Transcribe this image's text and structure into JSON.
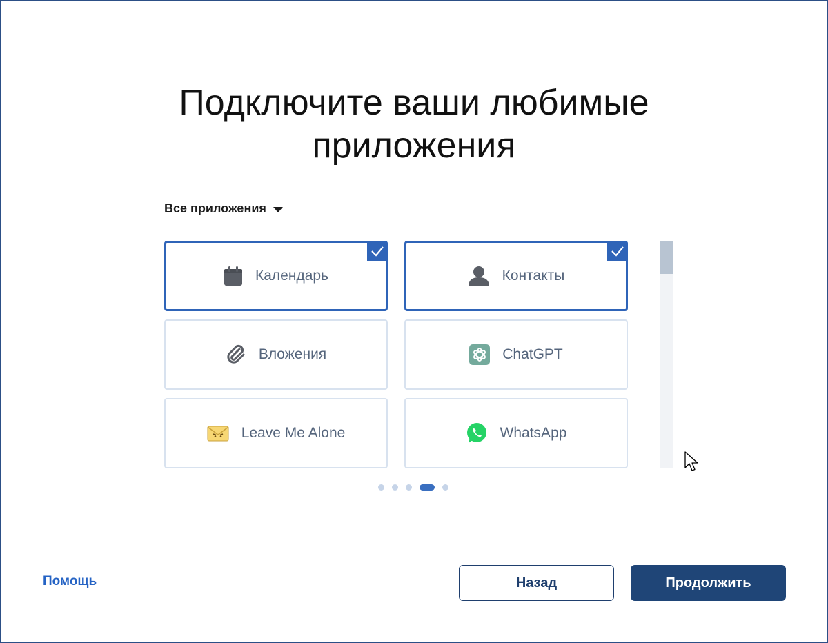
{
  "title_line1": "Подключите ваши любимые",
  "title_line2": "приложения",
  "filter": {
    "label": "Все приложения"
  },
  "apps": [
    {
      "label": "Календарь",
      "icon": "calendar-icon",
      "selected": true
    },
    {
      "label": "Контакты",
      "icon": "contact-person-icon",
      "selected": true
    },
    {
      "label": "Вложения",
      "icon": "paperclip-icon",
      "selected": false
    },
    {
      "label": "ChatGPT",
      "icon": "chatgpt-icon",
      "selected": false
    },
    {
      "label": "Leave Me Alone",
      "icon": "angry-envelope-icon",
      "selected": false
    },
    {
      "label": "WhatsApp",
      "icon": "whatsapp-icon",
      "selected": false
    }
  ],
  "pagination": {
    "pages": 5,
    "current": 4
  },
  "footer": {
    "help": "Помощь",
    "back": "Назад",
    "continue": "Продолжить"
  },
  "colors": {
    "accent": "#2f64b8",
    "primary_button": "#1f4577",
    "link": "#2563c4",
    "card_border": "#d8e2ef",
    "card_text": "#55657c"
  }
}
